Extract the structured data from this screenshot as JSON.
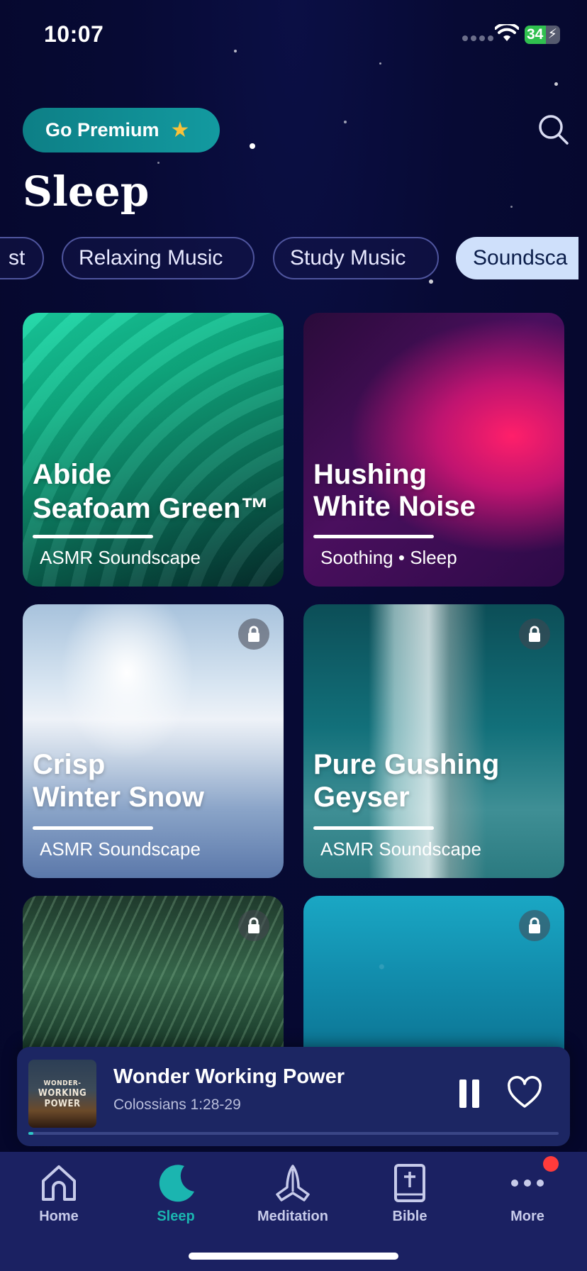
{
  "status_bar": {
    "time": "10:07",
    "battery": "34"
  },
  "header": {
    "premium_label": "Go Premium",
    "title": "Sleep"
  },
  "chips": [
    {
      "label": "st",
      "active": false
    },
    {
      "label": "Relaxing Music",
      "active": false
    },
    {
      "label": "Study Music",
      "active": false
    },
    {
      "label": "Soundsca",
      "active": true
    }
  ],
  "cards": [
    {
      "title_line1": "Abide",
      "title_line2": "Seafoam Green™",
      "subtitle": "ASMR Soundscape",
      "locked": false
    },
    {
      "title_line1": "Hushing",
      "title_line2": "White Noise",
      "subtitle": "Soothing • Sleep",
      "locked": false
    },
    {
      "title_line1": "Crisp",
      "title_line2": "Winter Snow",
      "subtitle": "ASMR Soundscape",
      "locked": true
    },
    {
      "title_line1": "Pure Gushing",
      "title_line2": "Geyser",
      "subtitle": "ASMR Soundscape",
      "locked": true
    },
    {
      "locked": true
    },
    {
      "locked": true
    }
  ],
  "now_playing": {
    "title": "Wonder Working Power",
    "subtitle": "Colossians 1:28-29",
    "cover_text": [
      "WONDER-",
      "WORKING",
      "POWER"
    ],
    "progress_percent": 1
  },
  "tabs": [
    {
      "label": "Home",
      "icon": "home-icon",
      "active": false
    },
    {
      "label": "Sleep",
      "icon": "moon-icon",
      "active": true
    },
    {
      "label": "Meditation",
      "icon": "praying-hands-icon",
      "active": false
    },
    {
      "label": "Bible",
      "icon": "bible-icon",
      "active": false
    },
    {
      "label": "More",
      "icon": "more-icon",
      "active": false,
      "badge": true
    }
  ],
  "colors": {
    "accent": "#1bb5b0",
    "background": "#07092f",
    "tabbar": "#1b2162",
    "premium": "#12939a"
  }
}
